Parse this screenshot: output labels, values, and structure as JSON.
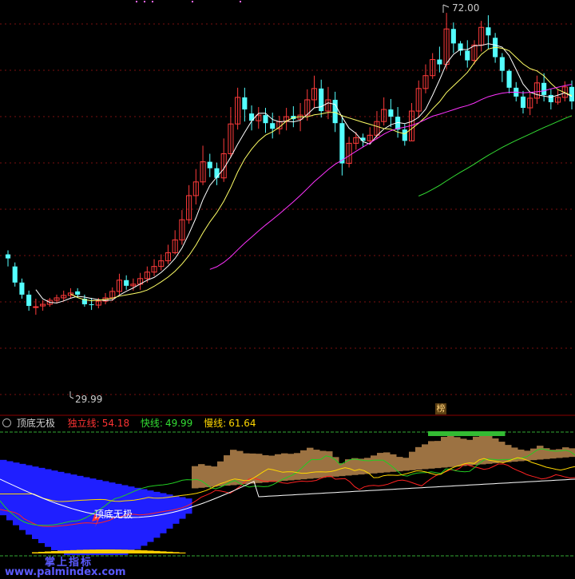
{
  "upper_panel": {
    "high_annotation": "72.00",
    "low_annotation": "29.99",
    "badge_text": "榜"
  },
  "indicator": {
    "name": "顶底无极",
    "line1_label": "独立线:",
    "line1_value": "54.18",
    "line2_label": "快线:",
    "line2_value": "49.99",
    "line3_label": "慢线:",
    "line3_value": "61.64",
    "signal_label": "顶底无极"
  },
  "watermark": {
    "line1": "掌上指标",
    "line2": "www.palmindex.com"
  },
  "colors": {
    "up_candle": "#ff3b3b",
    "down_candle": "#54ffff",
    "ma_fast": "#ffffff",
    "ma_mid": "#ffff66",
    "ma_slow": "#ff33ff",
    "ma_long": "#33dd33",
    "blue_area": "#1f1fff",
    "brown_area": "#9c7242",
    "green_cap": "#33bb33",
    "independent_line": "#ff2222",
    "fast_line": "#22cc22",
    "slow_line": "#ffd700"
  },
  "chart_data": {
    "type": "candlestick",
    "price_range": [
      24,
      73
    ],
    "candles": [
      [
        42,
        41.5,
        42.5,
        40.5
      ],
      [
        40.5,
        38.5,
        41,
        38
      ],
      [
        38.5,
        37,
        39,
        36.5
      ],
      [
        37,
        35.6,
        37.5,
        35
      ],
      [
        35.5,
        35.5,
        36.5,
        34.5
      ],
      [
        35.6,
        35.8,
        36.3,
        35
      ],
      [
        35.8,
        36.3,
        36.6,
        35.5
      ],
      [
        36.3,
        36.6,
        37,
        35.9
      ],
      [
        36.6,
        36.9,
        37.5,
        36.2
      ],
      [
        36.9,
        37.2,
        37.8,
        36.6
      ],
      [
        37.4,
        37,
        37.8,
        36.6
      ],
      [
        36.5,
        35.8,
        37,
        35.5
      ],
      [
        35.8,
        35.7,
        36.6,
        35.1
      ],
      [
        35.7,
        36.2,
        36.6,
        35.3
      ],
      [
        36.2,
        36.6,
        37.2,
        35.8
      ],
      [
        36.6,
        37.4,
        37.9,
        36.2
      ],
      [
        37.4,
        38.8,
        39.6,
        37
      ],
      [
        38.8,
        38.1,
        39.4,
        37.6
      ],
      [
        38.1,
        38.3,
        39,
        37.5
      ],
      [
        38.3,
        39,
        39.7,
        37.6
      ],
      [
        39,
        39.8,
        40.5,
        38.5
      ],
      [
        39.8,
        40.5,
        41.4,
        39.3
      ],
      [
        40.5,
        41.2,
        42,
        40
      ],
      [
        41.2,
        42.2,
        43.2,
        40.8
      ],
      [
        42.2,
        43.8,
        45,
        42
      ],
      [
        43.8,
        46.3,
        47.5,
        43.2
      ],
      [
        46.3,
        49.3,
        50.6,
        45.8
      ],
      [
        49.3,
        51,
        52.6,
        48.2
      ],
      [
        51,
        53.5,
        55.5,
        50.6
      ],
      [
        53.5,
        52.7,
        54.5,
        51.6
      ],
      [
        52.7,
        51.5,
        53.4,
        50.6
      ],
      [
        51.5,
        54.5,
        56.4,
        51
      ],
      [
        54.5,
        58.2,
        60.3,
        54
      ],
      [
        58.2,
        61.5,
        62.7,
        57.5
      ],
      [
        61.5,
        60,
        62.7,
        58.5
      ],
      [
        59.5,
        58.6,
        60.5,
        57.4
      ],
      [
        58.6,
        59.3,
        60.3,
        57.6
      ],
      [
        59.3,
        58.3,
        60.2,
        57.1
      ],
      [
        58.3,
        57.6,
        59.6,
        56.4
      ],
      [
        57.6,
        58.5,
        59.2,
        56.9
      ],
      [
        58.5,
        59.1,
        60.2,
        57.4
      ],
      [
        59.2,
        58.8,
        60.4,
        57.8
      ],
      [
        58.8,
        59.3,
        60.8,
        57.3
      ],
      [
        59.3,
        61.2,
        62.5,
        58.6
      ],
      [
        61.2,
        62.6,
        64.2,
        60.2
      ],
      [
        62.6,
        59.8,
        63.7,
        59
      ],
      [
        59.8,
        61.2,
        62.8,
        58.8
      ],
      [
        61.2,
        58.3,
        62.2,
        57.2
      ],
      [
        58.3,
        53.3,
        59.3,
        51.8
      ],
      [
        53.3,
        55.8,
        56.6,
        52.8
      ],
      [
        55.8,
        56.5,
        57.2,
        55
      ],
      [
        56.5,
        56.1,
        57,
        55.3
      ],
      [
        56.1,
        56.8,
        57.8,
        55.8
      ],
      [
        56.8,
        58.5,
        59.8,
        56.3
      ],
      [
        58.5,
        60,
        61.5,
        58
      ],
      [
        60,
        59.1,
        61.3,
        57.8
      ],
      [
        59.1,
        57.5,
        60.3,
        56.5
      ],
      [
        57.5,
        56.1,
        58.2,
        55.5
      ],
      [
        56.1,
        59.8,
        60.8,
        56.1
      ],
      [
        59.8,
        62.6,
        63.6,
        59
      ],
      [
        62.6,
        64.2,
        65.6,
        62
      ],
      [
        64.2,
        66.2,
        67,
        63.8
      ],
      [
        66.2,
        65.6,
        67.8,
        64.6
      ],
      [
        65.6,
        70,
        72,
        65
      ],
      [
        70,
        68.2,
        70.8,
        67
      ],
      [
        68.2,
        67.3,
        68.5,
        66.7
      ],
      [
        67.3,
        66.1,
        68.6,
        65.2
      ],
      [
        66.1,
        68,
        68.6,
        65.6
      ],
      [
        68,
        70.2,
        71,
        67.2
      ],
      [
        70.2,
        69.2,
        71.7,
        67.5
      ],
      [
        68.9,
        66.5,
        69.5,
        65.8
      ],
      [
        66.5,
        64.8,
        67,
        63.4
      ],
      [
        64.8,
        62.7,
        65,
        62
      ],
      [
        62.7,
        61.6,
        63.4,
        61
      ],
      [
        61.6,
        60.2,
        62.3,
        59.5
      ],
      [
        60.2,
        61.4,
        62.2,
        59.3
      ],
      [
        61.4,
        63.3,
        64.2,
        60.7
      ],
      [
        63.3,
        61.8,
        64.5,
        61
      ],
      [
        61.8,
        60.9,
        62.5,
        60
      ],
      [
        60.9,
        61.5,
        62.4,
        60.6
      ],
      [
        61.5,
        62.8,
        63.5,
        61
      ],
      [
        62.8,
        61,
        63.6,
        60
      ]
    ]
  }
}
